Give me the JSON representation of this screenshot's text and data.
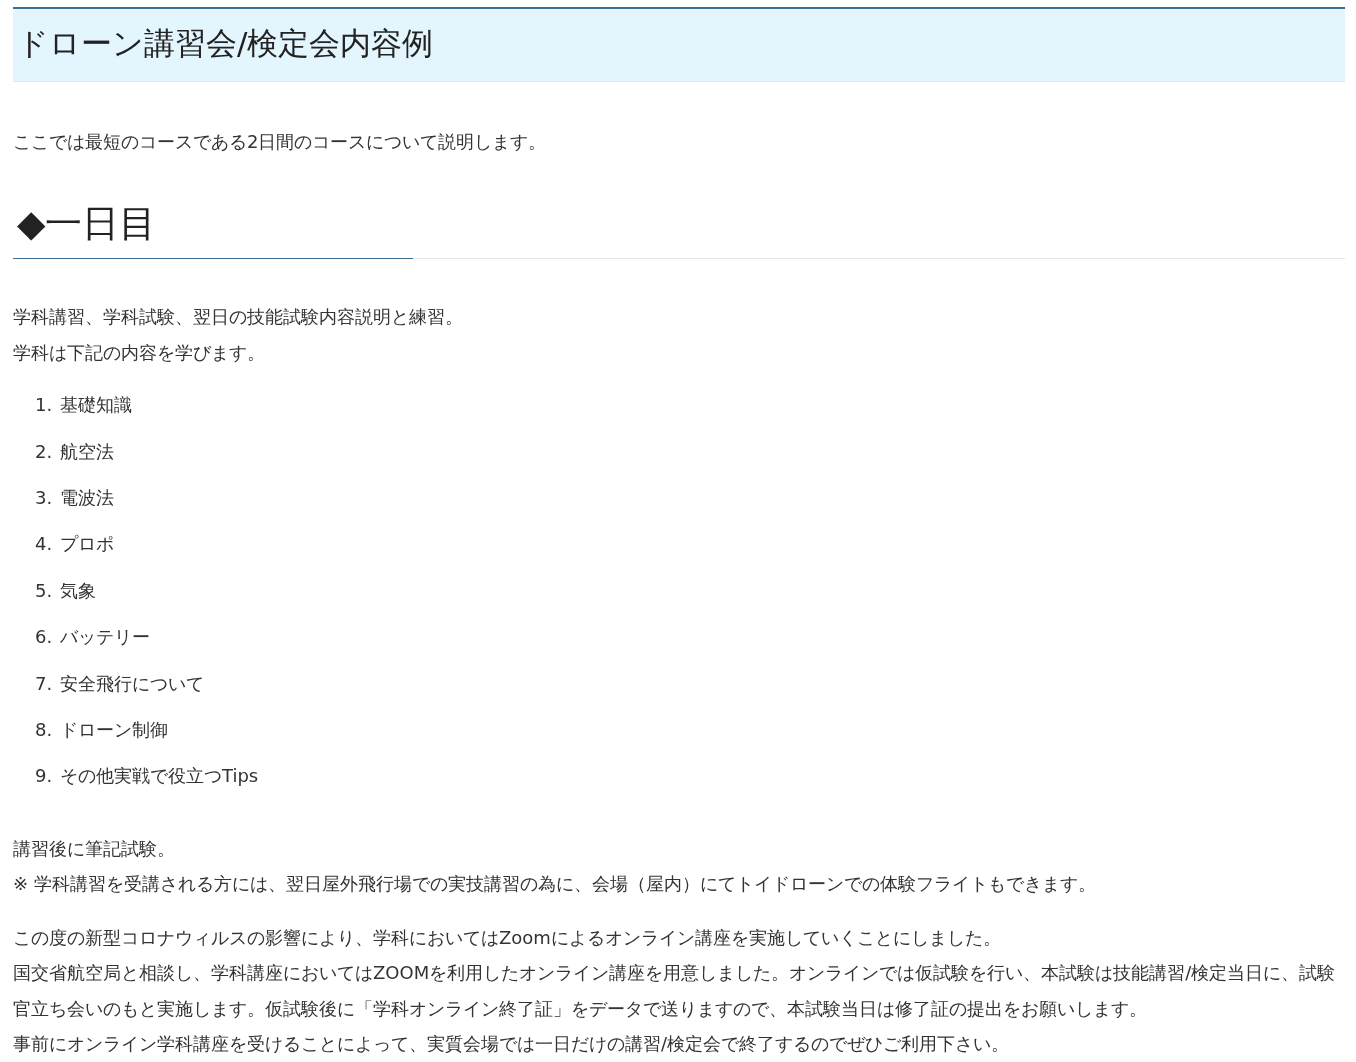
{
  "title": "ドローン講習会/検定会内容例",
  "intro": "ここでは最短のコースである2日間のコースについて説明します。",
  "section": {
    "heading": "◆一日目",
    "lead_lines": [
      "学科講習、学科試験、翌日の技能試験内容説明と練習。",
      "学科は下記の内容を学びます。"
    ],
    "topics": [
      {
        "number": "1.",
        "text": "基礎知識"
      },
      {
        "number": "2.",
        "text": "航空法"
      },
      {
        "number": "3.",
        "text": "電波法"
      },
      {
        "number": "4.",
        "text": "プロポ"
      },
      {
        "number": "5.",
        "text": "気象"
      },
      {
        "number": "6.",
        "text": "バッテリー"
      },
      {
        "number": "7.",
        "text": "安全飛行について"
      },
      {
        "number": "8.",
        "text": "ドローン制御"
      },
      {
        "number": "9.",
        "text": "その他実戦で役立つTips"
      }
    ],
    "after_lines": [
      "講習後に筆記試験。",
      "※ 学科講習を受講される方には、翌日屋外飛行場での実技講習の為に、会場（屋内）にてトイドローンでの体験フライトもできます。"
    ],
    "online_lines": [
      "この度の新型コロナウィルスの影響により、学科においてはZoomによるオンライン講座を実施していくことにしました。",
      "国交省航空局と相談し、学科講座においてはZOOMを利用したオンライン講座を用意しました。オンラインでは仮試験を行い、本試験は技能講習/検定当日に、試験官立ち会いのもと実施します。仮試験後に「学科オンライン終了証」をデータで送りますので、本試験当日は修了証の提出をお願いします。",
      "事前にオンライン学科講座を受けることによって、実質会場では一日だけの講習/検定会で終了するのでぜひご利用下さい。"
    ]
  }
}
